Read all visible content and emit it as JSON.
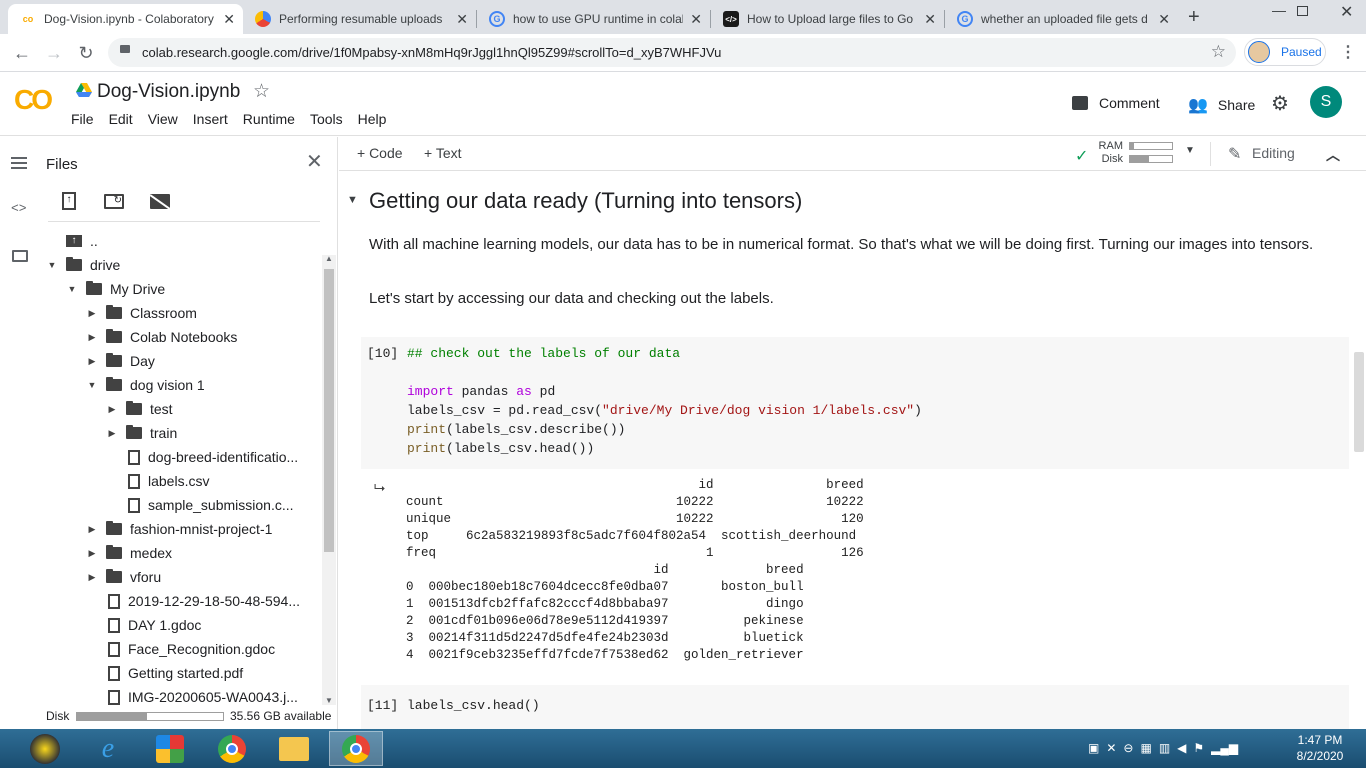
{
  "browser": {
    "tabs": [
      {
        "title": "Dog-Vision.ipynb - Colaboratory",
        "icon": "colab-icon",
        "active": true
      },
      {
        "title": "Performing resumable uploads",
        "icon": "gcloud-icon"
      },
      {
        "title": "how to use GPU runtime in colab",
        "icon": "google-icon"
      },
      {
        "title": "How to Upload large files to Go",
        "icon": "dev-icon"
      },
      {
        "title": "whether an uploaded file gets d",
        "icon": "google-icon"
      }
    ],
    "url": "colab.research.google.com/drive/1f0Mpabsy-xnM8mHq9rJggl1hnQl95Z99#scrollTo=d_xyB7WHFJVu",
    "profile_status": "Paused"
  },
  "colab": {
    "logo": "CO",
    "notebook_title": "Dog-Vision.ipynb",
    "menu": [
      "File",
      "Edit",
      "View",
      "Insert",
      "Runtime",
      "Tools",
      "Help"
    ],
    "comment_label": "Comment",
    "share_label": "Share",
    "avatar_letter": "S",
    "accent": "#f9ab00"
  },
  "files_panel": {
    "title": "Files",
    "disk_label": "Disk",
    "disk_available": "35.56 GB available",
    "disk_used_fraction": 0.48,
    "tree": [
      {
        "name": "..",
        "type": "up",
        "depth": 0
      },
      {
        "name": "drive",
        "type": "folder",
        "depth": 0,
        "expanded": true
      },
      {
        "name": "My Drive",
        "type": "folder",
        "depth": 1,
        "expanded": true
      },
      {
        "name": "Classroom",
        "type": "folder",
        "depth": 2
      },
      {
        "name": "Colab Notebooks",
        "type": "folder",
        "depth": 2
      },
      {
        "name": "Day",
        "type": "folder",
        "depth": 2
      },
      {
        "name": "dog vision 1",
        "type": "folder",
        "depth": 2,
        "expanded": true
      },
      {
        "name": "test",
        "type": "folder",
        "depth": 3
      },
      {
        "name": "train",
        "type": "folder",
        "depth": 3
      },
      {
        "name": "dog-breed-identificatio...",
        "type": "file",
        "depth": 3
      },
      {
        "name": "labels.csv",
        "type": "file",
        "depth": 3
      },
      {
        "name": "sample_submission.c...",
        "type": "file",
        "depth": 3
      },
      {
        "name": "fashion-mnist-project-1",
        "type": "folder",
        "depth": 2
      },
      {
        "name": "medex",
        "type": "folder",
        "depth": 2
      },
      {
        "name": "vforu",
        "type": "folder",
        "depth": 2
      },
      {
        "name": "2019-12-29-18-50-48-594...",
        "type": "file",
        "depth": 2
      },
      {
        "name": "DAY 1.gdoc",
        "type": "file",
        "depth": 2
      },
      {
        "name": "Face_Recognition.gdoc",
        "type": "file",
        "depth": 2
      },
      {
        "name": "Getting started.pdf",
        "type": "file",
        "depth": 2
      },
      {
        "name": "IMG-20200605-WA0043.j...",
        "type": "file",
        "depth": 2
      }
    ]
  },
  "toolbar": {
    "add_code": "+ Code",
    "add_text": "+ Text",
    "ram_label": "RAM",
    "disk_label": "Disk",
    "ram_fraction": 0.1,
    "disk_fraction": 0.45,
    "editing_label": "Editing"
  },
  "notebook": {
    "section_heading": "Getting our data ready (Turning into tensors)",
    "para1": "With all machine learning models, our data has to be in numerical format. So that's what we will be doing first. Turning our images into tensors.",
    "para2": "Let's start by accessing our data and checking out the labels.",
    "cell10": {
      "prompt": "[10]",
      "comment": "## check out the labels of our data",
      "line_import_kw": "import",
      "line_import_mid": " pandas ",
      "line_import_as": "as",
      "line_import_end": " pd",
      "line2_a": "labels_csv = pd.read_csv(",
      "line2_str": "\"drive/My Drive/dog vision 1/labels.csv\"",
      "line2_b": ")",
      "line3_kw": "print",
      "line3_rest": "(labels_csv.describe())",
      "line4_kw": "print",
      "line4_rest": "(labels_csv.head())"
    },
    "output_lines": [
      "                                       id               breed",
      "count                               10222               10222",
      "unique                              10222                 120",
      "top     6c2a583219893f8c5adc7f604f802a54  scottish_deerhound",
      "freq                                    1                 126",
      "                                 id             breed",
      "0  000bec180eb18c7604dcecc8fe0dba07       boston_bull",
      "1  001513dfcb2ffafc82cccf4d8bbaba97             dingo",
      "2  001cdf01b096e06d78e9e5112d419397          pekinese",
      "3  00214f311d5d2247d5dfe4fe24b2303d          bluetick",
      "4  0021f9ceb3235effd7fcde7f7538ed62  golden_retriever"
    ],
    "cell11": {
      "prompt": "[11]",
      "code": "labels_csv.head()"
    }
  },
  "taskbar": {
    "time": "1:47 PM",
    "date": "8/2/2020"
  }
}
